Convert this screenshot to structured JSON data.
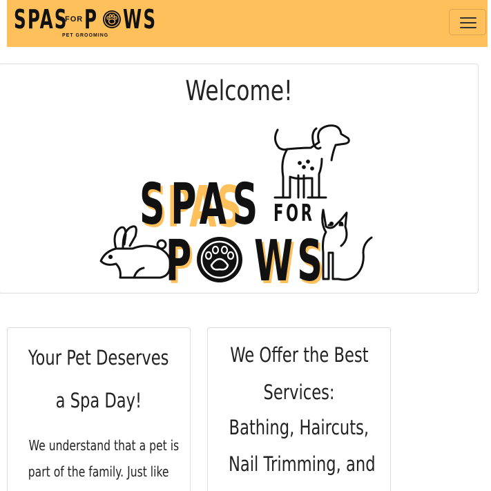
{
  "navbar": {
    "brand_word_left": "SPAS",
    "brand_for": "FOR",
    "brand_word_right_p": "P",
    "brand_word_right_rest": "WS",
    "brand_subtitle": "PET GROOMING",
    "background": "#fec05a",
    "toggler_icon": "hamburger-menu-icon"
  },
  "welcome": {
    "title": "Welcome!",
    "logo": {
      "line1": "SPAS",
      "for": "FOR",
      "line2_p": "P",
      "line2_rest": "WS",
      "accent": "#fec05a",
      "icons": [
        "dog-icon",
        "rabbit-icon",
        "cat-icon",
        "paw-icon"
      ]
    }
  },
  "cards": [
    {
      "heading_lines": [
        "Your Pet Deserves",
        "a Spa Day!"
      ],
      "text_lines": [
        "We understand that a pet is",
        "part of the family. Just like"
      ]
    },
    {
      "heading_lines": [
        "We Offer the Best",
        "Services:",
        "Bathing, Haircuts,",
        "Nail Trimming, and"
      ]
    }
  ]
}
